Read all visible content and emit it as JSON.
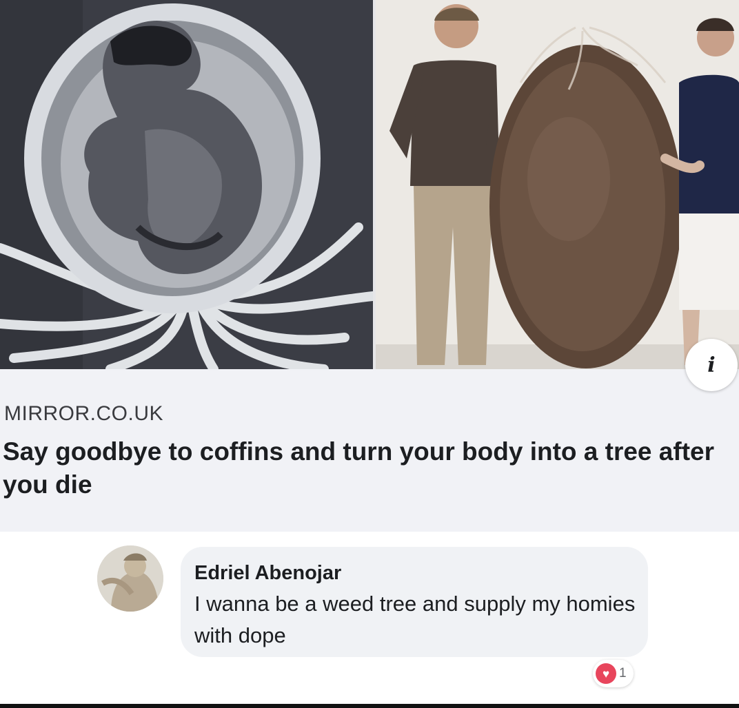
{
  "link_preview": {
    "source": "MIRROR.CO.UK",
    "headline": "Say goodbye to coffins and turn your body into a tree after you die",
    "info_glyph": "i",
    "images": [
      {
        "icon": "burial-pod-illustration"
      },
      {
        "icon": "burial-pod-photo"
      }
    ]
  },
  "comment": {
    "author": "Edriel Abenojar",
    "text": "I wanna be a weed tree and supply my homies with dope",
    "reaction": {
      "icon": "love-reaction-icon",
      "color": "#e8455c",
      "count": "1"
    }
  }
}
